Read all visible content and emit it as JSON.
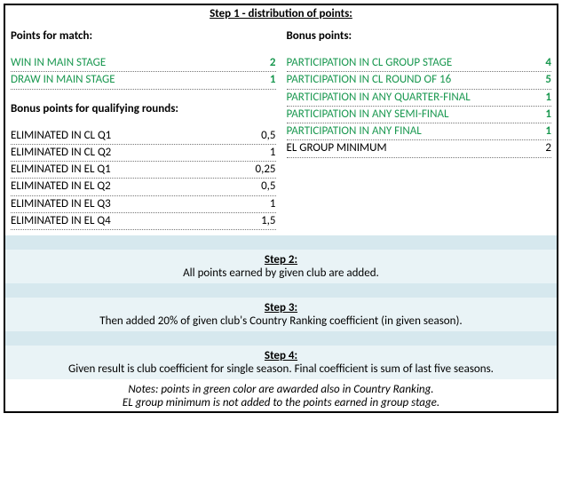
{
  "step1": {
    "title": "Step 1 - distribution of points:",
    "left": {
      "points_header": "Points for match:",
      "match_rows": [
        {
          "label": "WIN IN MAIN STAGE",
          "value": "2"
        },
        {
          "label": "DRAW IN MAIN STAGE",
          "value": "1"
        }
      ],
      "bonus_q_header": "Bonus points for qualifying rounds:",
      "q_rows": [
        {
          "label": "ELIMINATED IN CL Q1",
          "value": "0,5"
        },
        {
          "label": "ELIMINATED IN CL Q2",
          "value": "1"
        },
        {
          "label": "ELIMINATED IN EL Q1",
          "value": "0,25"
        },
        {
          "label": "ELIMINATED IN EL Q2",
          "value": "0,5"
        },
        {
          "label": "ELIMINATED IN EL Q3",
          "value": "1"
        },
        {
          "label": "ELIMINATED IN EL Q4",
          "value": "1,5"
        }
      ]
    },
    "right": {
      "bonus_header": "Bonus points:",
      "bonus_rows_green": [
        {
          "label": "PARTICIPATION IN CL GROUP STAGE",
          "value": "4"
        },
        {
          "label": "PARTICIPATION IN CL ROUND OF 16",
          "value": "5"
        },
        {
          "label": "PARTICIPATION IN ANY QUARTER-FINAL",
          "value": "1"
        },
        {
          "label": "PARTICIPATION IN ANY SEMI-FINAL",
          "value": "1"
        },
        {
          "label": "PARTICIPATION IN ANY FINAL",
          "value": "1"
        }
      ],
      "bonus_row_black": {
        "label": "EL GROUP MINIMUM",
        "value": "2"
      }
    }
  },
  "step2": {
    "head": "Step 2:",
    "body": "All points earned by given club are added."
  },
  "step3": {
    "head": "Step 3:",
    "body": "Then added 20% of given club's Country Ranking coefficient (in given season)."
  },
  "step4": {
    "head": "Step 4:",
    "body": "Given result is club coefficient for single season. Final coefficient is sum of last five seasons."
  },
  "notes": {
    "line1": "Notes: points in green color are awarded also in Country Ranking.",
    "line2": "EL group minimum is not added to the points earned in group stage."
  }
}
